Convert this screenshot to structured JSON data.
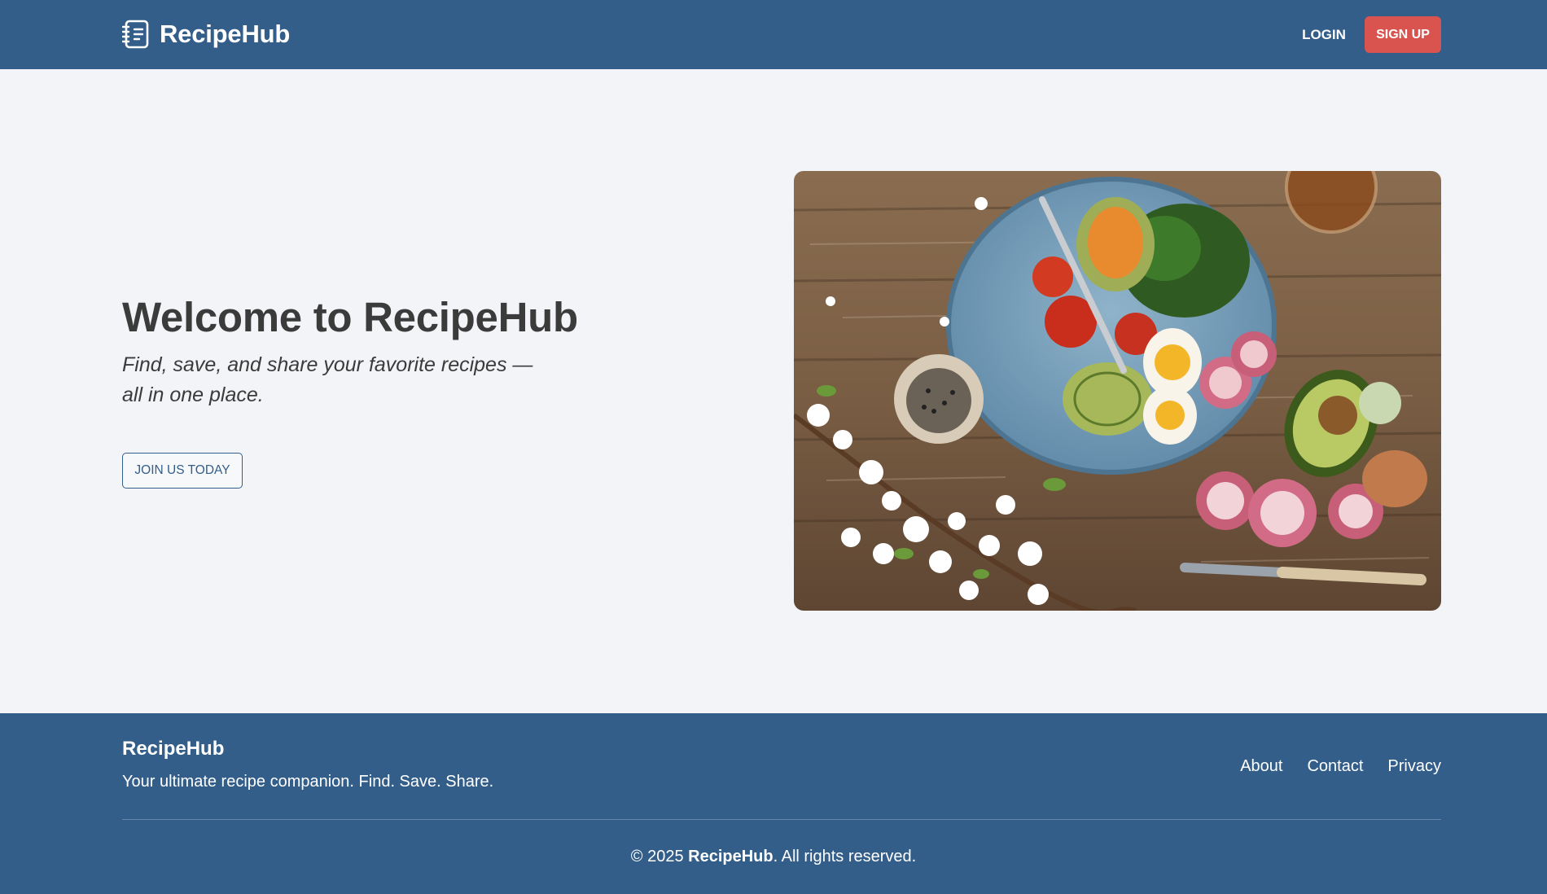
{
  "header": {
    "brand_name": "RecipeHub",
    "brand_icon": "recipe-book-icon",
    "login_label": "LOGIN",
    "signup_label": "SIGN UP"
  },
  "hero": {
    "title": "Welcome to RecipeHub",
    "subtitle": "Find, save, and share your favorite recipes — all in one place.",
    "cta_label": "JOIN US TODAY",
    "image_icon": "food-plate-photo"
  },
  "footer": {
    "brand_name": "RecipeHub",
    "tagline": "Your ultimate recipe companion. Find. Save. Share.",
    "links": [
      {
        "label": "About"
      },
      {
        "label": "Contact"
      },
      {
        "label": "Privacy"
      }
    ],
    "copyright_prefix": "© 2025 ",
    "copyright_brand": "RecipeHub",
    "copyright_suffix": ". All rights reserved."
  },
  "colors": {
    "header_bg": "#335e8a",
    "footer_bg": "#335e8a",
    "page_bg": "#f2f4f7",
    "signup_bg": "#d9534f",
    "text_dark": "#3b3b3b"
  }
}
